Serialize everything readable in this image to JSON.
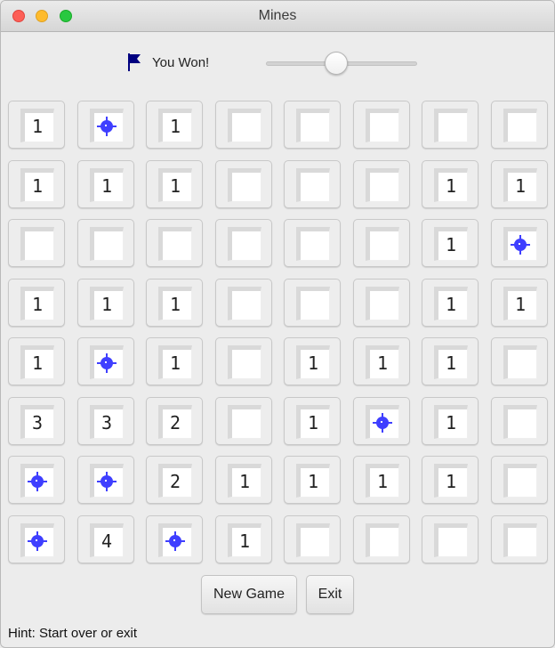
{
  "window": {
    "title": "Mines"
  },
  "status": {
    "text": "You Won!",
    "icon": "flag-icon"
  },
  "slider": {
    "value": 0.45
  },
  "board": {
    "rows": 8,
    "cols": 8,
    "cells": [
      [
        "1",
        "mine",
        "1",
        "",
        "",
        "",
        "",
        ""
      ],
      [
        "1",
        "1",
        "1",
        "",
        "",
        "",
        "1",
        "1"
      ],
      [
        "",
        "",
        "",
        "",
        "",
        "",
        "1",
        "mine"
      ],
      [
        "1",
        "1",
        "1",
        "",
        "",
        "",
        "1",
        "1"
      ],
      [
        "1",
        "mine",
        "1",
        "",
        "1",
        "1",
        "1",
        ""
      ],
      [
        "3",
        "3",
        "2",
        "",
        "1",
        "mine",
        "1",
        ""
      ],
      [
        "mine",
        "mine",
        "2",
        "1",
        "1",
        "1",
        "1",
        ""
      ],
      [
        "mine",
        "4",
        "mine",
        "1",
        "",
        "",
        "",
        ""
      ]
    ]
  },
  "buttons": {
    "new_game": "New Game",
    "exit": "Exit"
  },
  "hint": "Hint: Start over or exit",
  "colors": {
    "mine": "#3f3fff",
    "flag": "#000080"
  }
}
